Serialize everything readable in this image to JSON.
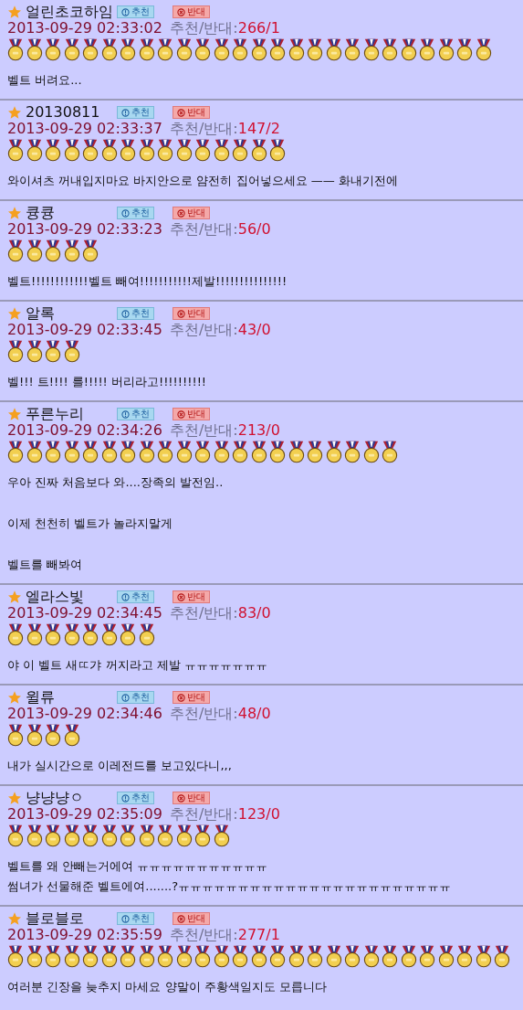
{
  "comments": [
    {
      "author": "얼린초코하임",
      "recommend": "추천",
      "oppose": "반대",
      "time": "2013-09-29 02:33:02",
      "votes_label": "추천/반대:",
      "votes": "266/1",
      "medals": [
        {
          "kind": "gold"
        },
        {
          "kind": "gold"
        },
        {
          "kind": "gold"
        },
        {
          "kind": "gold"
        },
        {
          "kind": "gold"
        },
        {
          "kind": "gold"
        },
        {
          "kind": "gold"
        },
        {
          "kind": "gold"
        },
        {
          "kind": "gold"
        },
        {
          "kind": "gold"
        },
        {
          "kind": "gold"
        },
        {
          "kind": "gold"
        },
        {
          "kind": "gold"
        },
        {
          "kind": "gold"
        },
        {
          "kind": "gold"
        },
        {
          "kind": "gold"
        },
        {
          "kind": "gold"
        },
        {
          "kind": "gold"
        },
        {
          "kind": "gold"
        },
        {
          "kind": "gold"
        },
        {
          "kind": "gold"
        },
        {
          "kind": "gold"
        },
        {
          "kind": "gold"
        },
        {
          "kind": "gold"
        },
        {
          "kind": "gold"
        },
        {
          "kind": "gold"
        }
      ],
      "body": [
        [
          "벨트 버려요..."
        ]
      ]
    },
    {
      "author": "20130811",
      "recommend": "추천",
      "oppose": "반대",
      "time": "2013-09-29 02:33:37",
      "votes_label": "추천/반대:",
      "votes": "147/2",
      "medals": [
        {
          "kind": "gold"
        },
        {
          "kind": "gold"
        },
        {
          "kind": "gold"
        },
        {
          "kind": "gold"
        },
        {
          "kind": "gold"
        },
        {
          "kind": "gold"
        },
        {
          "kind": "gold"
        },
        {
          "kind": "gold"
        },
        {
          "kind": "gold"
        },
        {
          "kind": "gold"
        },
        {
          "kind": "gold"
        },
        {
          "kind": "gold"
        },
        {
          "kind": "gold"
        },
        {
          "kind": "gold"
        },
        {
          "kind": "gold"
        }
      ],
      "body": [
        [
          "와이셔츠 꺼내입지마요 바지안으로 얌전히 집어넣으세요 —— 화내기전에"
        ]
      ]
    },
    {
      "author": "큥큥",
      "recommend": "추천",
      "oppose": "반대",
      "time": "2013-09-29 02:33:23",
      "votes_label": "추천/반대:",
      "votes": "56/0",
      "medals": [
        {
          "kind": "gold"
        },
        {
          "kind": "gold"
        },
        {
          "kind": "gold"
        },
        {
          "kind": "gold"
        },
        {
          "kind": "gold"
        }
      ],
      "body": [
        [
          "벨트!!!!!!!!!!!!벨트 빼여!!!!!!!!!!!제발!!!!!!!!!!!!!!!"
        ]
      ]
    },
    {
      "author": "알록",
      "recommend": "추천",
      "oppose": "반대",
      "time": "2013-09-29 02:33:45",
      "votes_label": "추천/반대:",
      "votes": "43/0",
      "medals": [
        {
          "kind": "gold"
        },
        {
          "kind": "gold"
        },
        {
          "kind": "gold"
        },
        {
          "kind": "gold"
        }
      ],
      "body": [
        [
          "벨!!! 트!!!! 를!!!!! 버리라고!!!!!!!!!!"
        ]
      ]
    },
    {
      "author": "푸른누리",
      "recommend": "추천",
      "oppose": "반대",
      "time": "2013-09-29 02:34:26",
      "votes_label": "추천/반대:",
      "votes": "213/0",
      "medals": [
        {
          "kind": "gold"
        },
        {
          "kind": "gold"
        },
        {
          "kind": "gold"
        },
        {
          "kind": "gold"
        },
        {
          "kind": "gold"
        },
        {
          "kind": "gold"
        },
        {
          "kind": "gold"
        },
        {
          "kind": "gold"
        },
        {
          "kind": "gold"
        },
        {
          "kind": "gold"
        },
        {
          "kind": "gold"
        },
        {
          "kind": "gold"
        },
        {
          "kind": "gold"
        },
        {
          "kind": "gold"
        },
        {
          "kind": "gold"
        },
        {
          "kind": "gold"
        },
        {
          "kind": "gold"
        },
        {
          "kind": "gold"
        },
        {
          "kind": "gold"
        },
        {
          "kind": "gold"
        },
        {
          "kind": "gold"
        }
      ],
      "body": [
        [
          "우아 진짜 처음보다 와....장족의 발전임.."
        ],
        [
          "이제 천천히 벨트가 놀라지말게"
        ],
        [
          "벨트를 빼봐여"
        ]
      ]
    },
    {
      "author": "엘라스빛",
      "recommend": "추천",
      "oppose": "반대",
      "time": "2013-09-29 02:34:45",
      "votes_label": "추천/반대:",
      "votes": "83/0",
      "medals": [
        {
          "kind": "gold"
        },
        {
          "kind": "gold"
        },
        {
          "kind": "gold"
        },
        {
          "kind": "gold"
        },
        {
          "kind": "gold"
        },
        {
          "kind": "gold"
        },
        {
          "kind": "gold"
        },
        {
          "kind": "gold"
        }
      ],
      "body": [
        [
          "야 이 벨트 새ㄸ갸 꺼지라고 제발 ㅠㅠㅠㅠㅠㅠㅠ"
        ]
      ]
    },
    {
      "author": "윌류",
      "recommend": "추천",
      "oppose": "반대",
      "time": "2013-09-29 02:34:46",
      "votes_label": "추천/반대:",
      "votes": "48/0",
      "medals": [
        {
          "kind": "gold"
        },
        {
          "kind": "gold"
        },
        {
          "kind": "gold"
        },
        {
          "kind": "gold"
        }
      ],
      "body": [
        [
          "내가 실시간으로 이레전드를 보고있다니,,,"
        ]
      ]
    },
    {
      "author": "냥냥냥ㅇ",
      "recommend": "추천",
      "oppose": "반대",
      "time": "2013-09-29 02:35:09",
      "votes_label": "추천/반대:",
      "votes": "123/0",
      "medals": [
        {
          "kind": "gold"
        },
        {
          "kind": "gold"
        },
        {
          "kind": "gold"
        },
        {
          "kind": "gold"
        },
        {
          "kind": "gold"
        },
        {
          "kind": "gold"
        },
        {
          "kind": "gold"
        },
        {
          "kind": "gold"
        },
        {
          "kind": "gold"
        },
        {
          "kind": "gold"
        },
        {
          "kind": "gold"
        },
        {
          "kind": "gold"
        }
      ],
      "body": [
        [
          "벨트를 왜 안빼는거에여 ㅠㅠㅠㅠㅠㅠㅠㅠㅠㅠㅠ",
          "썸녀가 선물해준 벨트에여.......?ㅠㅠㅠㅠㅠㅠㅠㅠㅠㅠㅠㅠㅠㅠㅠㅠㅠㅠㅠㅠㅠㅠㅠ"
        ]
      ]
    },
    {
      "author": "블로블로",
      "recommend": "추천",
      "oppose": "반대",
      "time": "2013-09-29 02:35:59",
      "votes_label": "추천/반대:",
      "votes": "277/1",
      "medals": [
        {
          "kind": "gold"
        },
        {
          "kind": "gold"
        },
        {
          "kind": "gold"
        },
        {
          "kind": "gold"
        },
        {
          "kind": "gold"
        },
        {
          "kind": "gold"
        },
        {
          "kind": "gold"
        },
        {
          "kind": "gold"
        },
        {
          "kind": "gold"
        },
        {
          "kind": "gold"
        },
        {
          "kind": "gold"
        },
        {
          "kind": "gold"
        },
        {
          "kind": "gold"
        },
        {
          "kind": "gold"
        },
        {
          "kind": "gold"
        },
        {
          "kind": "gold"
        },
        {
          "kind": "gold"
        },
        {
          "kind": "gold"
        },
        {
          "kind": "gold"
        },
        {
          "kind": "gold"
        },
        {
          "kind": "gold"
        },
        {
          "kind": "gold"
        },
        {
          "kind": "gold"
        },
        {
          "kind": "gold"
        },
        {
          "kind": "gold"
        },
        {
          "kind": "gold"
        },
        {
          "kind": "gold"
        }
      ],
      "body": [
        [
          "여러분 긴장을 늦추지 마세요 양말이 주황색일지도 모릅니다"
        ]
      ]
    }
  ]
}
